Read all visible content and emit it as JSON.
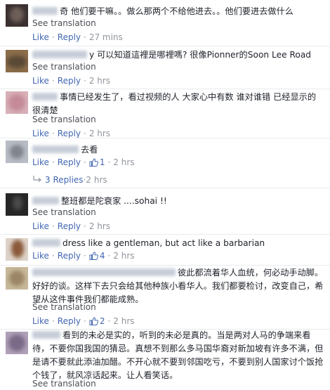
{
  "ui": {
    "see_translation": "See translation",
    "like": "Like",
    "reply": "Reply",
    "dot": "·"
  },
  "comments": [
    {
      "text_after_name": "奇 他们要干嘛。。做么那两个不给他进去。。他们要进去做什么",
      "time": "27 mins"
    },
    {
      "text_after_name": "y 可以知道這裡是哪裡嗎? 很像Pionner的Soon Lee Road",
      "time": "2 hrs"
    },
    {
      "text_after_name": "事情已经发生了，看过视频的人 大家心中有数 谁对谁错 已经显示的很清楚",
      "time": "2 hrs"
    },
    {
      "text_after_name": "去看",
      "likes": "1",
      "time": "2 hrs",
      "replies_label": "3 Replies",
      "replies_time": "2 hrs"
    },
    {
      "text_after_name": "整班都是陀衰家 ....sohai !!",
      "time": "2 hrs"
    },
    {
      "text_after_name": "dress like a gentleman, but act like a barbarian",
      "likes": "4",
      "time": "2 hrs"
    },
    {
      "text_after_name": "彼此都流着华人血统，何必动手动脚。好好的谈。这样下去只会给其他种族小看华人。我们都要检讨，改变自己，希望从这件事件我们都能成熟。",
      "likes": "2",
      "time": "2 hrs"
    },
    {
      "text_after_name": "看到的未必是实的，听到的未必是真的。当是两对人马的争端来看待，不要你国我国的猜忌。真想不到那么多马国华裔对新加坡有许多不满，但是请不要就此添油加醋。不开心就不要到邻国吃亏，不要到别人国家讨个饭抢个钱了，就风凉话起来。让人看笑话。"
    }
  ]
}
